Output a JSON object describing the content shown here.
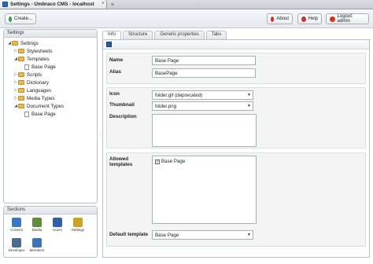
{
  "browser": {
    "tab_title": "Settings - Umbraco CMS - localhost",
    "close_glyph": "×",
    "newtab_glyph": "+"
  },
  "toolbar": {
    "create_label": "Create...",
    "about_label": "About",
    "help_label": "Help",
    "logout_label": "Logout: admin"
  },
  "settings_panel": {
    "title": "Settings",
    "tree": [
      {
        "label": "Settings",
        "level": 0,
        "type": "folder",
        "expanded": true
      },
      {
        "label": "Stylesheets",
        "level": 1,
        "type": "folder",
        "expanded": false
      },
      {
        "label": "Templates",
        "level": 1,
        "type": "folder",
        "expanded": true
      },
      {
        "label": "Base Page",
        "level": 2,
        "type": "doc"
      },
      {
        "label": "Scripts",
        "level": 1,
        "type": "folder",
        "expanded": false
      },
      {
        "label": "Dictionary",
        "level": 1,
        "type": "folder",
        "expanded": false
      },
      {
        "label": "Languages",
        "level": 1,
        "type": "folder",
        "expanded": false
      },
      {
        "label": "Media Types",
        "level": 1,
        "type": "folder",
        "expanded": false
      },
      {
        "label": "Document Types",
        "level": 1,
        "type": "folder",
        "expanded": true
      },
      {
        "label": "Base Page",
        "level": 2,
        "type": "doc"
      }
    ]
  },
  "sections_panel": {
    "title": "Sections",
    "items": [
      {
        "label": "Content",
        "icon": "content-icon",
        "color": "#3a76c4"
      },
      {
        "label": "Media",
        "icon": "media-icon",
        "color": "#5b8f3a"
      },
      {
        "label": "Users",
        "icon": "users-icon",
        "color": "#2f5fa8"
      },
      {
        "label": "Settings",
        "icon": "settings-icon",
        "color": "#c9a224"
      },
      {
        "label": "Developer",
        "icon": "developer-icon",
        "color": "#4a6a8f"
      },
      {
        "label": "Members",
        "icon": "members-icon",
        "color": "#3d73b8"
      }
    ]
  },
  "main": {
    "tabs": [
      "Info",
      "Structure",
      "Generic properties",
      "Tabs"
    ],
    "active_tab": "Info",
    "form": {
      "name_label": "Name",
      "name_value": "Base Page",
      "alias_label": "Alias",
      "alias_value": "BasePage",
      "icon_label": "Icon",
      "icon_value": "folder.gif (deprecated)",
      "thumbnail_label": "Thumbnail",
      "thumbnail_value": "folder.png",
      "description_label": "Description",
      "allowed_templates_label": "Allowed templates",
      "allowed_template_item": "Base Page",
      "default_template_label": "Default template",
      "default_template_value": "Base Page"
    }
  },
  "colors": {
    "accent": "#2b5aa8",
    "folder": "#e9b94a",
    "help_green": "#3c9e3c",
    "logout_red": "#c9352b"
  }
}
